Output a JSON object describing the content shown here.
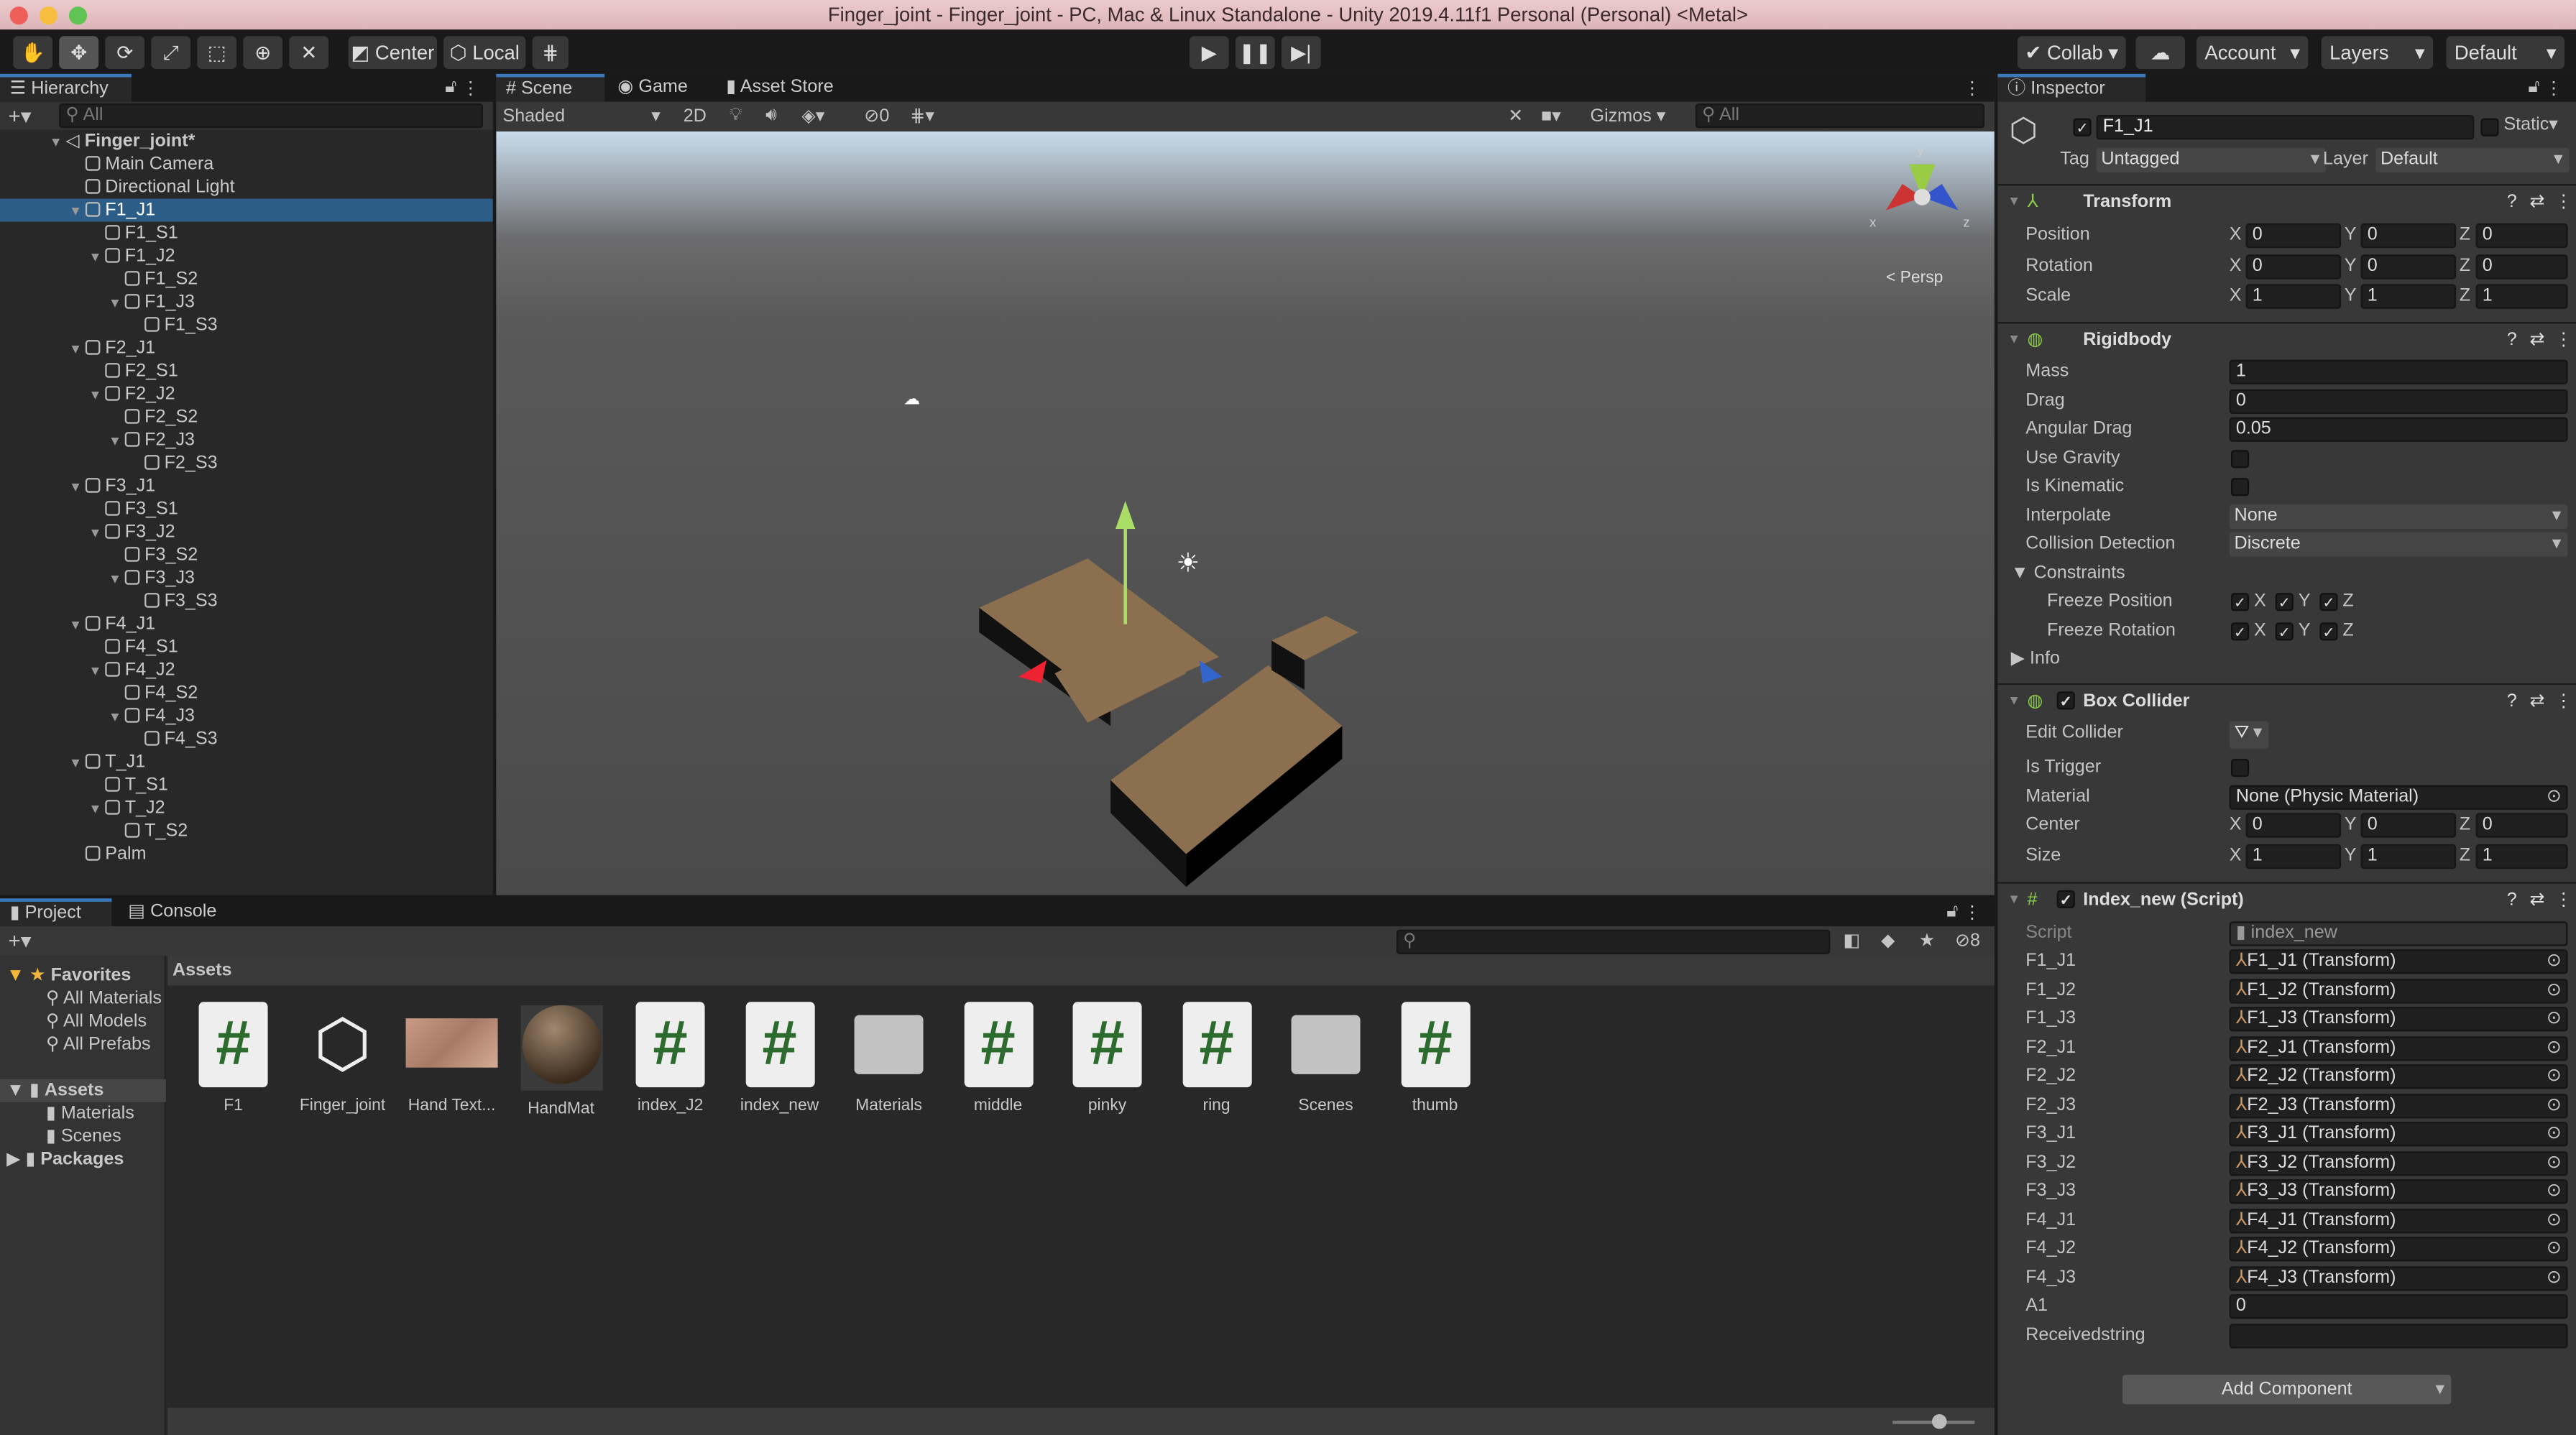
{
  "window": {
    "title": "Finger_joint - Finger_joint - PC, Mac & Linux Standalone - Unity 2019.4.11f1 Personal (Personal) <Metal>"
  },
  "toolbar": {
    "tools": [
      "hand-tool",
      "move-tool",
      "rotate-tool",
      "scale-tool",
      "rect-tool",
      "transform-tool",
      "custom-tool"
    ],
    "pivot": "Center",
    "space": "Local",
    "collab": "Collab",
    "account": "Account",
    "layers": "Layers",
    "layout": "Default"
  },
  "hierarchy": {
    "tab": "Hierarchy",
    "search_placeholder": "All",
    "items": [
      {
        "label": "Finger_joint*",
        "level": 0,
        "arrow": true,
        "scene": true
      },
      {
        "label": "Main Camera",
        "level": 1
      },
      {
        "label": "Directional Light",
        "level": 1
      },
      {
        "label": "F1_J1",
        "level": 1,
        "arrow": true,
        "selected": true
      },
      {
        "label": "F1_S1",
        "level": 2
      },
      {
        "label": "F1_J2",
        "level": 2,
        "arrow": true
      },
      {
        "label": "F1_S2",
        "level": 3
      },
      {
        "label": "F1_J3",
        "level": 3,
        "arrow": true
      },
      {
        "label": "F1_S3",
        "level": 4
      },
      {
        "label": "F2_J1",
        "level": 1,
        "arrow": true
      },
      {
        "label": "F2_S1",
        "level": 2
      },
      {
        "label": "F2_J2",
        "level": 2,
        "arrow": true
      },
      {
        "label": "F2_S2",
        "level": 3
      },
      {
        "label": "F2_J3",
        "level": 3,
        "arrow": true
      },
      {
        "label": "F2_S3",
        "level": 4
      },
      {
        "label": "F3_J1",
        "level": 1,
        "arrow": true
      },
      {
        "label": "F3_S1",
        "level": 2
      },
      {
        "label": "F3_J2",
        "level": 2,
        "arrow": true
      },
      {
        "label": "F3_S2",
        "level": 3
      },
      {
        "label": "F3_J3",
        "level": 3,
        "arrow": true
      },
      {
        "label": "F3_S3",
        "level": 4
      },
      {
        "label": "F4_J1",
        "level": 1,
        "arrow": true
      },
      {
        "label": "F4_S1",
        "level": 2
      },
      {
        "label": "F4_J2",
        "level": 2,
        "arrow": true
      },
      {
        "label": "F4_S2",
        "level": 3
      },
      {
        "label": "F4_J3",
        "level": 3,
        "arrow": true
      },
      {
        "label": "F4_S3",
        "level": 4
      },
      {
        "label": "T_J1",
        "level": 1,
        "arrow": true
      },
      {
        "label": "T_S1",
        "level": 2
      },
      {
        "label": "T_J2",
        "level": 2,
        "arrow": true
      },
      {
        "label": "T_S2",
        "level": 3
      },
      {
        "label": "Palm",
        "level": 1
      }
    ]
  },
  "scene": {
    "tabs": [
      "Scene",
      "Game",
      "Asset Store"
    ],
    "shading": "Shaded",
    "mode2d": "2D",
    "hidden_count": "0",
    "gizmos": "Gizmos",
    "search_placeholder": "All",
    "persp": "Persp",
    "axes": [
      "x",
      "y",
      "z"
    ]
  },
  "inspector": {
    "tab": "Inspector",
    "object_name": "F1_J1",
    "static": "Static",
    "tag_label": "Tag",
    "tag": "Untagged",
    "layer_label": "Layer",
    "layer": "Default",
    "transform": {
      "title": "Transform",
      "rows": [
        {
          "label": "Position",
          "x": "0",
          "y": "0",
          "z": "0"
        },
        {
          "label": "Rotation",
          "x": "0",
          "y": "0",
          "z": "0"
        },
        {
          "label": "Scale",
          "x": "1",
          "y": "1",
          "z": "1"
        }
      ]
    },
    "rigidbody": {
      "title": "Rigidbody",
      "mass_label": "Mass",
      "mass": "1",
      "drag_label": "Drag",
      "drag": "0",
      "angular_label": "Angular Drag",
      "angular": "0.05",
      "gravity_label": "Use Gravity",
      "kinematic_label": "Is Kinematic",
      "interpolate_label": "Interpolate",
      "interpolate": "None",
      "collision_label": "Collision Detection",
      "collision": "Discrete",
      "constraints_label": "Constraints",
      "freeze_pos_label": "Freeze Position",
      "freeze_rot_label": "Freeze Rotation",
      "info_label": "Info"
    },
    "box_collider": {
      "title": "Box Collider",
      "edit_label": "Edit Collider",
      "trigger_label": "Is Trigger",
      "material_label": "Material",
      "material": "None (Physic Material)",
      "center_label": "Center",
      "center": {
        "x": "0",
        "y": "0",
        "z": "0"
      },
      "size_label": "Size",
      "size": {
        "x": "1",
        "y": "1",
        "z": "1"
      }
    },
    "script": {
      "title": "Index_new (Script)",
      "script_label": "Script",
      "script": "index_new",
      "fields": [
        {
          "label": "F1_J1",
          "value": "F1_J1 (Transform)"
        },
        {
          "label": "F1_J2",
          "value": "F1_J2 (Transform)"
        },
        {
          "label": "F1_J3",
          "value": "F1_J3 (Transform)"
        },
        {
          "label": "F2_J1",
          "value": "F2_J1 (Transform)"
        },
        {
          "label": "F2_J2",
          "value": "F2_J2 (Transform)"
        },
        {
          "label": "F2_J3",
          "value": "F2_J3 (Transform)"
        },
        {
          "label": "F3_J1",
          "value": "F3_J1 (Transform)"
        },
        {
          "label": "F3_J2",
          "value": "F3_J2 (Transform)"
        },
        {
          "label": "F3_J3",
          "value": "F3_J3 (Transform)"
        },
        {
          "label": "F4_J1",
          "value": "F4_J1 (Transform)"
        },
        {
          "label": "F4_J2",
          "value": "F4_J2 (Transform)"
        },
        {
          "label": "F4_J3",
          "value": "F4_J3 (Transform)"
        }
      ],
      "a1_label": "A1",
      "a1": "0",
      "recv_label": "Receivedstring",
      "recv": ""
    },
    "add_component": "Add Component"
  },
  "project": {
    "tabs": [
      "Project",
      "Console"
    ],
    "hidden_count": "8",
    "breadcrumb": "Assets",
    "tree": [
      {
        "label": "Favorites",
        "level": 0
      },
      {
        "label": "All Materials",
        "level": 1
      },
      {
        "label": "All Models",
        "level": 1
      },
      {
        "label": "All Prefabs",
        "level": 1
      },
      {
        "label": "Assets",
        "level": 0
      },
      {
        "label": "Materials",
        "level": 1
      },
      {
        "label": "Scenes",
        "level": 1
      },
      {
        "label": "Packages",
        "level": 0
      }
    ],
    "assets": [
      {
        "name": "F1",
        "type": "script"
      },
      {
        "name": "Finger_joint",
        "type": "scene"
      },
      {
        "name": "Hand Text...",
        "type": "texture"
      },
      {
        "name": "HandMat",
        "type": "material"
      },
      {
        "name": "index_J2",
        "type": "script"
      },
      {
        "name": "index_new",
        "type": "script"
      },
      {
        "name": "Materials",
        "type": "folder"
      },
      {
        "name": "middle",
        "type": "script"
      },
      {
        "name": "pinky",
        "type": "script"
      },
      {
        "name": "ring",
        "type": "script"
      },
      {
        "name": "Scenes",
        "type": "folder"
      },
      {
        "name": "thumb",
        "type": "script"
      }
    ]
  },
  "colors": {
    "selection": "#2c5d87",
    "accent": "#3a79bb",
    "script_hash": "#2d6a2d",
    "block": "#8b6f4e"
  }
}
